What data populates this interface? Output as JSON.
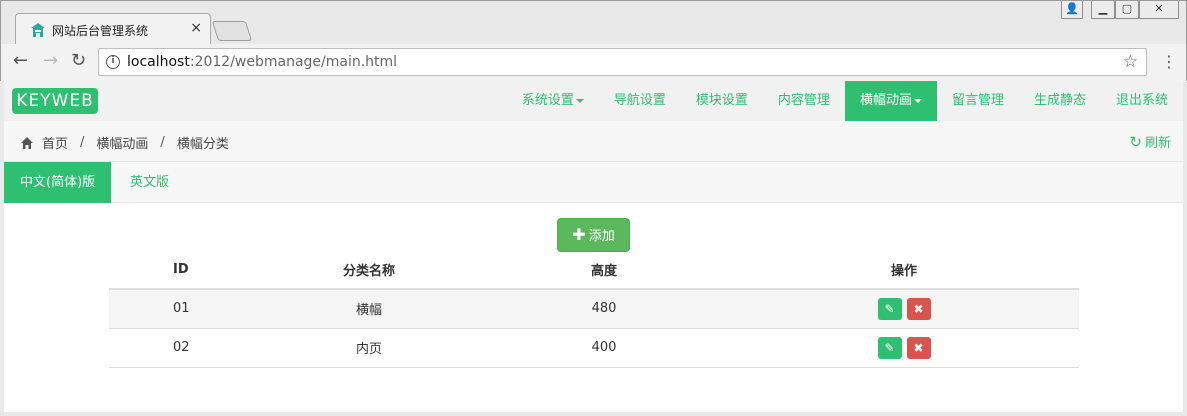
{
  "browser": {
    "tab_title": "网站后台管理系统",
    "tab_close": "×",
    "url_host": "localhost",
    "url_rest": ":2012/webmanage/main.html",
    "window_controls": {
      "user": "👤",
      "min": "▁",
      "max": "▢",
      "close": "✕"
    }
  },
  "nav": {
    "logo": "KEYWEB",
    "items": [
      {
        "label": "系统设置",
        "dropdown": true,
        "active": false
      },
      {
        "label": "导航设置",
        "dropdown": false,
        "active": false
      },
      {
        "label": "模块设置",
        "dropdown": false,
        "active": false
      },
      {
        "label": "内容管理",
        "dropdown": false,
        "active": false
      },
      {
        "label": "横幅动画",
        "dropdown": true,
        "active": true
      },
      {
        "label": "留言管理",
        "dropdown": false,
        "active": false
      },
      {
        "label": "生成静态",
        "dropdown": false,
        "active": false
      },
      {
        "label": "退出系统",
        "dropdown": false,
        "active": false
      }
    ]
  },
  "breadcrumb": {
    "home": "首页",
    "level1": "横幅动画",
    "level2": "横幅分类",
    "refresh": "刷新"
  },
  "lang_tabs": {
    "zh": "中文(简体)版",
    "en": "英文版"
  },
  "add_button": "添加",
  "table": {
    "headers": {
      "id": "ID",
      "name": "分类名称",
      "height": "高度",
      "ops": "操作"
    },
    "rows": [
      {
        "id": "01",
        "name": "横幅",
        "height": "480"
      },
      {
        "id": "02",
        "name": "内页",
        "height": "400"
      }
    ]
  },
  "colors": {
    "accent": "#2fbf71",
    "add": "#5cb85c",
    "danger": "#d9534f"
  }
}
